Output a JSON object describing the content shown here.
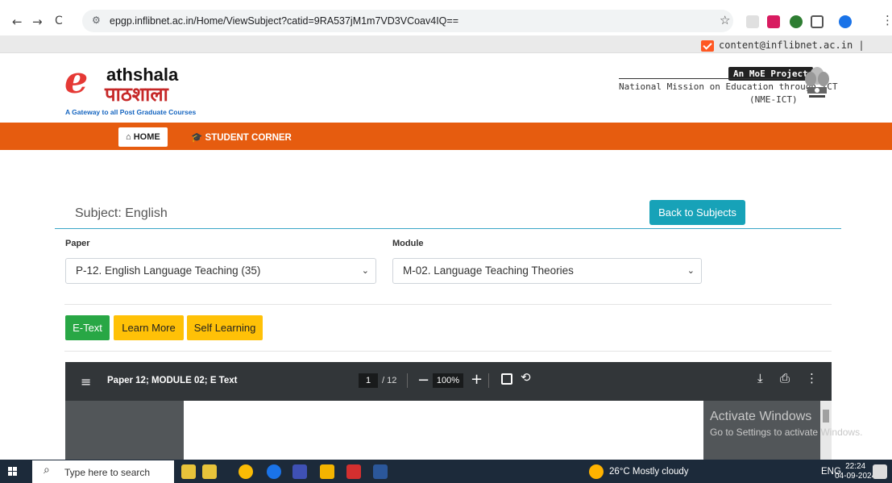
{
  "browser": {
    "url": "epgp.inflibnet.ac.in/Home/ViewSubject?catid=9RA537jM1m7VD3VCoav4IQ==",
    "back_glyph": "←",
    "forward_glyph": "→",
    "reload_glyph": "C",
    "site_info_glyph": "⚙",
    "star_glyph": "☆",
    "menu_glyph": "⋮"
  },
  "contact": {
    "email": "content@inflibnet.ac.in",
    "separator": "|"
  },
  "header": {
    "logo_e": "e",
    "logo_title": "athshala",
    "logo_hindi": "पाठशाला",
    "logo_tagline": "A Gateway to all Post Graduate Courses",
    "moe_badge": "An MoE Project",
    "nme_title": "National Mission on Education through ICT",
    "nme_abbr": "(NME-ICT)"
  },
  "navbar": {
    "home_label": "HOME",
    "home_icon": "⌂",
    "student_label": "STUDENT CORNER",
    "student_icon": "🎓"
  },
  "subject": {
    "title": "Subject: English",
    "back_button": "Back to Subjects"
  },
  "filters": {
    "paper_label": "Paper",
    "paper_value": "P-12. English Language Teaching (35)",
    "module_label": "Module",
    "module_value": "M-02. Language Teaching Theories",
    "chevron": "⌄"
  },
  "tabs": {
    "etext": "E-Text",
    "learn_more": "Learn More",
    "self_learning": "Self Learning"
  },
  "pdf": {
    "menu_glyph": "≡",
    "title": "Paper 12; MODULE 02; E Text",
    "current_page": "1",
    "total_pages": "/ 12",
    "minus_glyph": "−",
    "zoom": "100%",
    "plus_glyph": "+",
    "rotate_glyph": "⟲",
    "download_glyph": "⤓",
    "print_glyph": "⎙",
    "more_glyph": "⋮"
  },
  "watermark": {
    "line1": "Activate Windows",
    "line2": "Go to Settings to activate Windows."
  },
  "taskbar": {
    "search_placeholder": "Type here to search",
    "search_glyph": "⌕",
    "weather": "26°C  Mostly cloudy",
    "lang": "ENG",
    "time": "22:24",
    "date": "04-09-2024"
  },
  "colors": {
    "navbar": "#e65c0f",
    "teal": "#17a2b8",
    "green": "#28a745",
    "amber": "#ffc107",
    "pdf_toolbar": "#323639"
  }
}
